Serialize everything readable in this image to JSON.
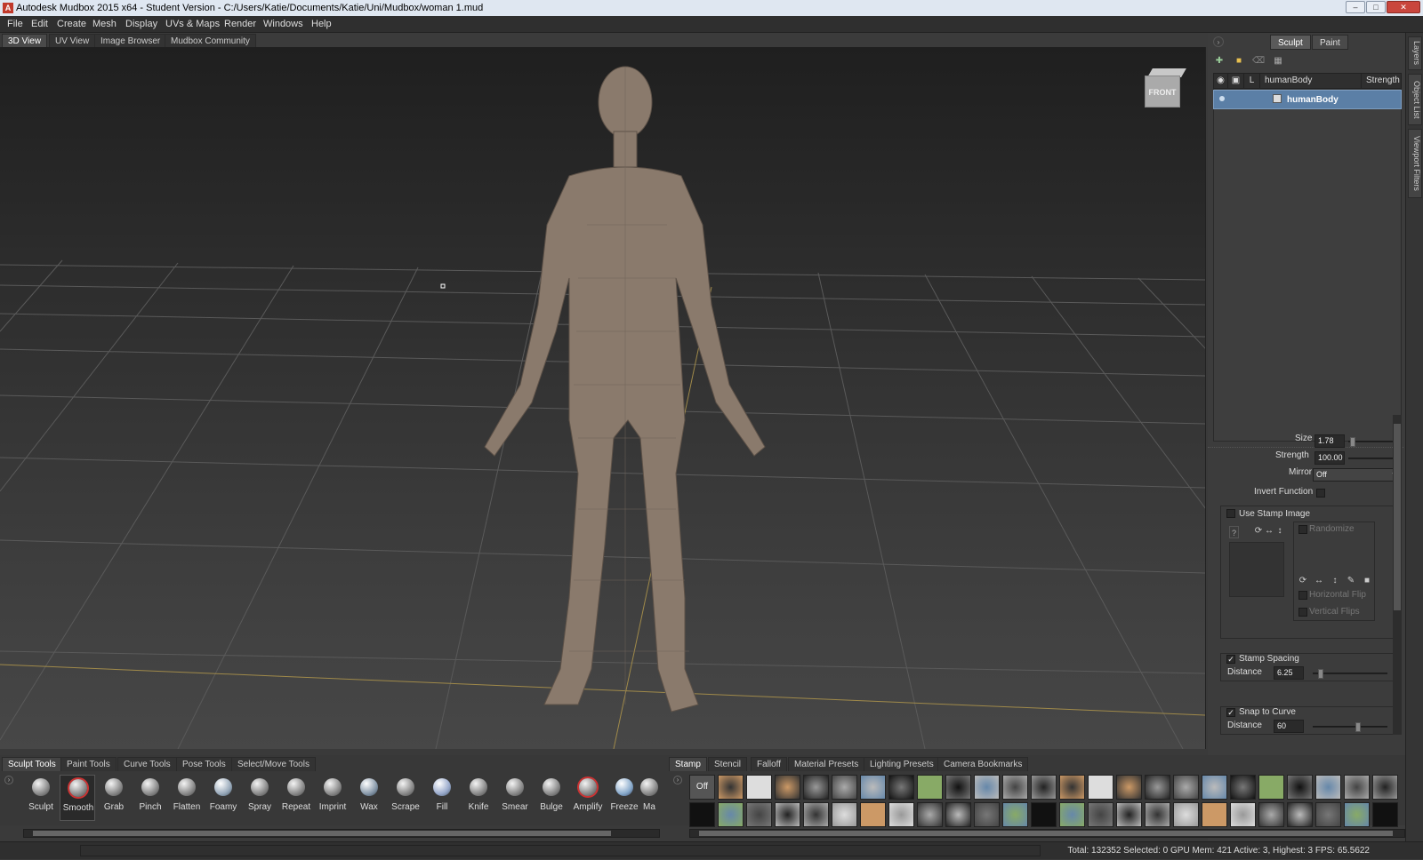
{
  "window": {
    "title": "Autodesk Mudbox 2015 x64 - Student Version - C:/Users/Katie/Documents/Katie/Uni/Mudbox/woman 1.mud"
  },
  "menu": [
    "File",
    "Edit",
    "Create",
    "Mesh",
    "Display",
    "UVs & Maps",
    "Render",
    "Windows",
    "Help"
  ],
  "view_tabs": [
    "3D View",
    "UV View",
    "Image Browser",
    "Mudbox Community"
  ],
  "viewcube_label": "FRONT",
  "right_panel": {
    "mode_tabs": [
      "Sculpt",
      "Paint"
    ],
    "layer_header": {
      "name": "humanBody",
      "strength": "Strength",
      "lock": "L"
    },
    "layer_row": "humanBody",
    "side_tabs": [
      "Layers",
      "Object List",
      "Viewport Filters"
    ],
    "props": {
      "size_label": "Size",
      "size_value": "1.78",
      "strength_label": "Strength",
      "strength_value": "100.00",
      "mirror_label": "Mirror",
      "mirror_value": "Off",
      "invert_label": "Invert Function",
      "use_stamp_label": "Use Stamp Image",
      "randomize_label": "Randomize",
      "hflip_label": "Horizontal Flip",
      "vflip_label": "Vertical Flips",
      "stamp_spacing_label": "Stamp Spacing",
      "spacing_distance_label": "Distance",
      "spacing_distance_value": "6.25",
      "snap_label": "Snap to Curve",
      "snap_distance_label": "Distance",
      "snap_distance_value": "60"
    }
  },
  "tool_tabs": [
    "Sculpt Tools",
    "Paint Tools",
    "Curve Tools",
    "Pose Tools",
    "Select/Move Tools"
  ],
  "tools": [
    "Sculpt",
    "Smooth",
    "Grab",
    "Pinch",
    "Flatten",
    "Foamy",
    "Spray",
    "Repeat",
    "Imprint",
    "Wax",
    "Scrape",
    "Fill",
    "Knife",
    "Smear",
    "Bulge",
    "Amplify",
    "Freeze",
    "Ma"
  ],
  "tray_tabs": [
    "Stamp",
    "Stencil",
    "Falloff",
    "Material Presets",
    "Lighting Presets",
    "Camera Bookmarks"
  ],
  "stamp_off_label": "Off",
  "status": "Total: 132352  Selected: 0 GPU Mem: 421  Active: 3, Highest: 3  FPS: 65.5622"
}
